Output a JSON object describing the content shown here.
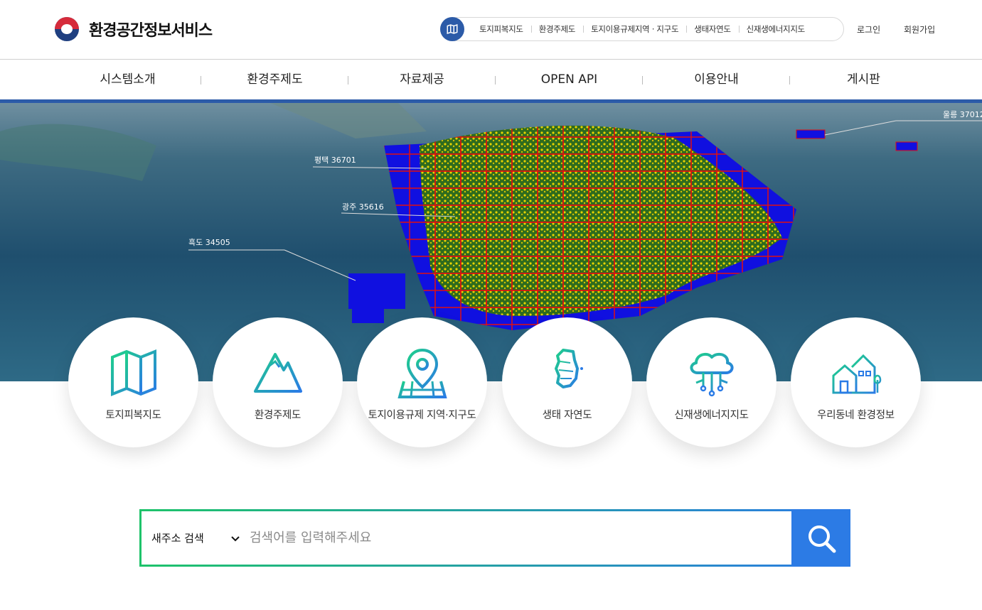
{
  "header": {
    "logo_title": "환경공간정보서비스",
    "quick_links": [
      "토지피복지도",
      "환경주제도",
      "토지이용규제지역 · 지구도",
      "생태자연도",
      "신재생에너지지도"
    ],
    "login": "로그인",
    "signup": "회원가입"
  },
  "gnb": [
    "시스템소개",
    "환경주제도",
    "자료제공",
    "OPEN API",
    "이용안내",
    "게시판"
  ],
  "hero": {
    "callouts": [
      "평택 36701",
      "광주 35616",
      "흑도 34505",
      "울릉 37012"
    ]
  },
  "cards": [
    {
      "label": "토지피복지도"
    },
    {
      "label": "환경주제도"
    },
    {
      "label": "토지이용규제 지역·지구도"
    },
    {
      "label": "생태 자연도"
    },
    {
      "label": "신재생에너지지도"
    },
    {
      "label": "우리동네 환경정보"
    }
  ],
  "search": {
    "select_value": "새주소 검색",
    "placeholder": "검색어를 입력해주세요"
  },
  "colors": {
    "brand_blue": "#2c5ba8",
    "search_blue": "#2c7be5",
    "search_green": "#1ec36a"
  }
}
